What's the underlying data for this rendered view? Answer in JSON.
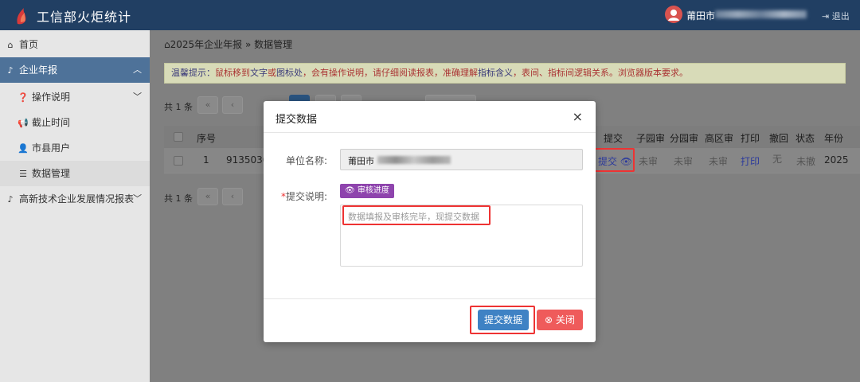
{
  "header": {
    "app_title": "工信部火炬统计",
    "user_name": "莆田市",
    "logout_label": "退出",
    "accent": "#213f63"
  },
  "sidebar": {
    "items": [
      {
        "icon": "home-icon",
        "label": "首页"
      },
      {
        "icon": "bell-icon",
        "label": "企业年报"
      },
      {
        "icon": "question-circle-icon",
        "label": "操作说明"
      },
      {
        "icon": "bullhorn-icon",
        "label": "截止时间"
      },
      {
        "icon": "user-icon",
        "label": "市县用户"
      },
      {
        "icon": "list-icon",
        "label": "数据管理"
      },
      {
        "icon": "bell-icon",
        "label": "高新技术企业发展情况报表"
      }
    ]
  },
  "main": {
    "breadcrumb": "2025年企业年报 » 数据管理",
    "tip": {
      "prefix": "温馨提示：",
      "text1": "鼠标移到",
      "text2": "文字",
      "text3": "或",
      "text4": "图标处",
      "text5": "，会有操作说明，请仔细阅读报表，准确理解",
      "text6": "指标含义",
      "text7": "，表间、指标间逻辑关系。浏览器版本要求。"
    },
    "pager_count": "共 1 条",
    "pager_first": "«",
    "pager_prev": "‹",
    "table": {
      "headers": [
        "序号",
        "提交",
        "子园审",
        "分园审",
        "高区审",
        "打印",
        "撤回",
        "状态",
        "年份"
      ],
      "row": {
        "index": "1",
        "code": "9135030",
        "submit": "提交",
        "sub_park": "未审",
        "branch_park": "未审",
        "high_zone": "未审",
        "print": "打印",
        "withdraw": "无",
        "status": "未撤",
        "year": "2025"
      }
    }
  },
  "modal": {
    "title": "提交数据",
    "close_symbol": "×",
    "unit_label": "单位名称:",
    "unit_value": "莆田市",
    "desc_label": "提交说明:",
    "required_mark": "*",
    "progress_button": "审核进度",
    "desc_placeholder": "数据填报及审核完毕，现提交数据",
    "submit_button": "提交数据",
    "close_button": "关闭"
  }
}
